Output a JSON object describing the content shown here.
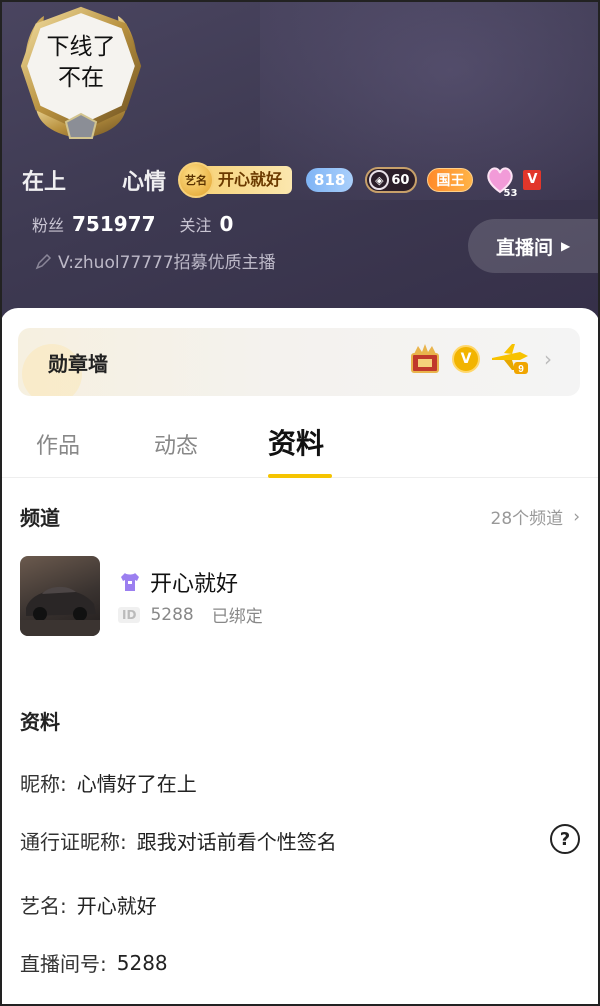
{
  "header": {
    "avatar_text": "下线了\n不在",
    "nickname_left": "在上",
    "nickname_right": "心情",
    "artist_badge": {
      "coin_label": "艺名",
      "name": "开心就好"
    },
    "level_badge": "818",
    "vip_badge": "60",
    "king_badge": "国王",
    "heart_badge_level": "53",
    "v_badge": "V",
    "fans_label": "粉丝",
    "fans_count": "751977",
    "follow_label": "关注",
    "follow_count": "0",
    "signature": "V:zhuol77777招募优质主播",
    "live_room_button": "直播间",
    "live_room_arrow": "▶"
  },
  "medal_wall": {
    "title": "勋章墙",
    "v_medal": "V",
    "plane_level": "9",
    "chevron": "›"
  },
  "tabs": [
    {
      "label": "作品",
      "active": false
    },
    {
      "label": "动态",
      "active": false
    },
    {
      "label": "资料",
      "active": true
    }
  ],
  "channels": {
    "title": "频道",
    "more_label": "28个频道",
    "chevron": "›",
    "item": {
      "name": "开心就好",
      "id_tag": "ID",
      "id": "5288",
      "status": "已绑定"
    }
  },
  "profile": {
    "title": "资料",
    "rows": [
      {
        "key": "昵称:",
        "value": "心情好了在上"
      },
      {
        "key": "通行证昵称:",
        "value": "跟我对话前看个性签名"
      },
      {
        "key": "艺名:",
        "value": "开心就好"
      },
      {
        "key": "直播间号:",
        "value": "5288"
      }
    ],
    "help_icon": "?"
  },
  "colors": {
    "header_bg": "#3e3a52",
    "tab_underline": "#f5c400",
    "level_badge": "#7fb4f5",
    "king_badge": "#ff8a2a",
    "artist_badge": "#f7d37b"
  }
}
